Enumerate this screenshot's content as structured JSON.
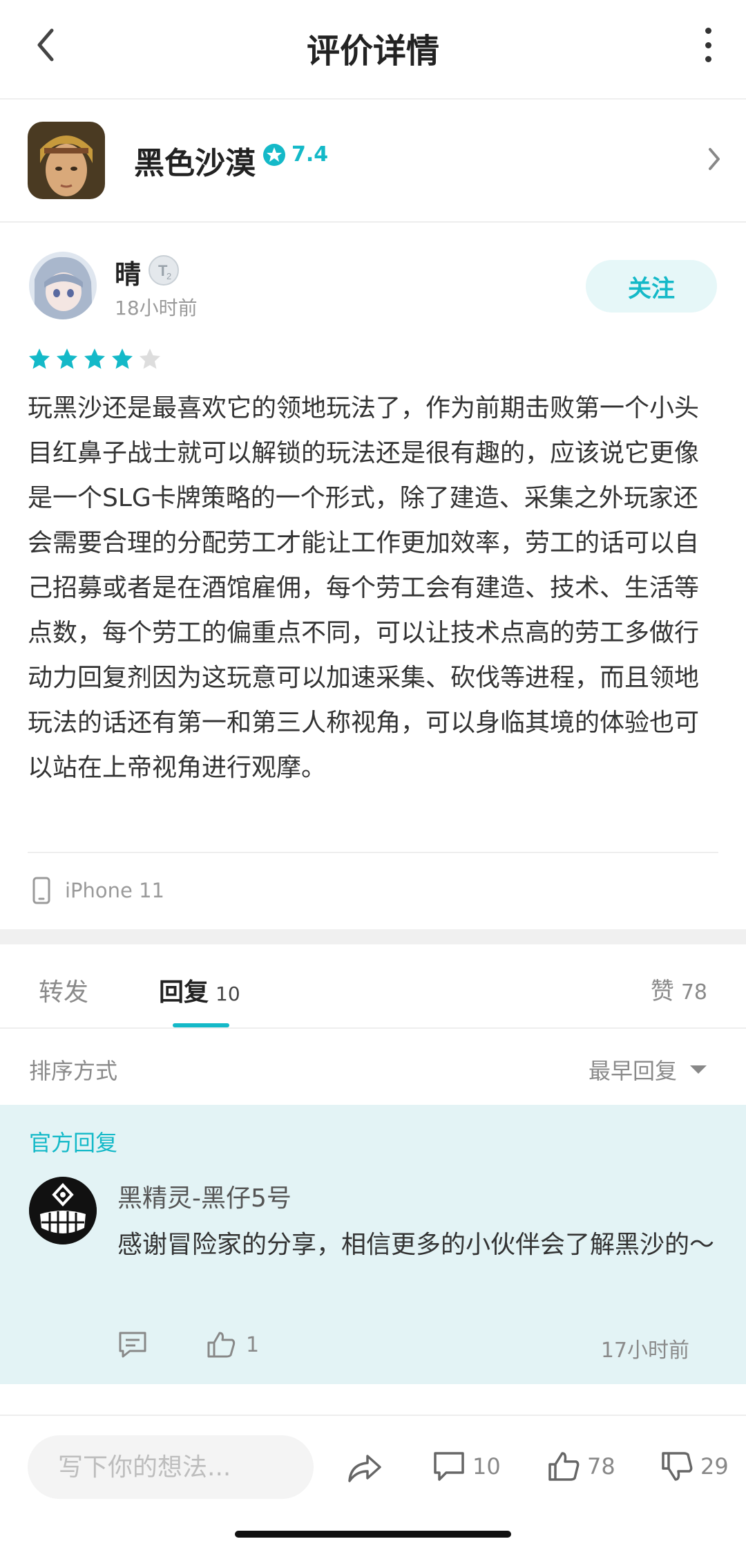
{
  "header": {
    "title": "评价详情"
  },
  "app": {
    "name": "黑色沙漠",
    "rating": "7.4"
  },
  "review": {
    "author": "晴",
    "time": "18小时前",
    "follow_label": "关注",
    "stars": 4,
    "stars_max": 5,
    "text": "玩黑沙还是最喜欢它的领地玩法了，作为前期击败第一个小头目红鼻子战士就可以解锁的玩法还是很有趣的，应该说它更像是一个SLG卡牌策略的一个形式，除了建造、采集之外玩家还会需要合理的分配劳工才能让工作更加效率，劳工的话可以自己招募或者是在酒馆雇佣，每个劳工会有建造、技术、生活等点数，每个劳工的偏重点不同，可以让技术点高的劳工多做行动力回复剂因为这玩意可以加速采集、砍伐等进程，而且领地玩法的话还有第一和第三人称视角，可以身临其境的体验也可以站在上帝视角进行观摩。",
    "device": "iPhone 11"
  },
  "tabs": {
    "forward_label": "转发",
    "reply_label": "回复",
    "reply_count": "10",
    "likes_label": "赞",
    "likes_count": "78"
  },
  "sort": {
    "label": "排序方式",
    "selected": "最早回复"
  },
  "official_reply": {
    "label": "官方回复",
    "author": "黑精灵-黑仔5号",
    "text": "感谢冒险家的分享，相信更多的小伙伴会了解黑沙的～",
    "likes": "1",
    "time": "17小时前"
  },
  "bottom_bar": {
    "placeholder": "写下你的想法...",
    "comments": "10",
    "likes": "78",
    "dislikes": "29"
  },
  "colors": {
    "accent": "#14b9c8",
    "official_bg": "#e3f3f5",
    "star_empty": "#dddddd"
  }
}
